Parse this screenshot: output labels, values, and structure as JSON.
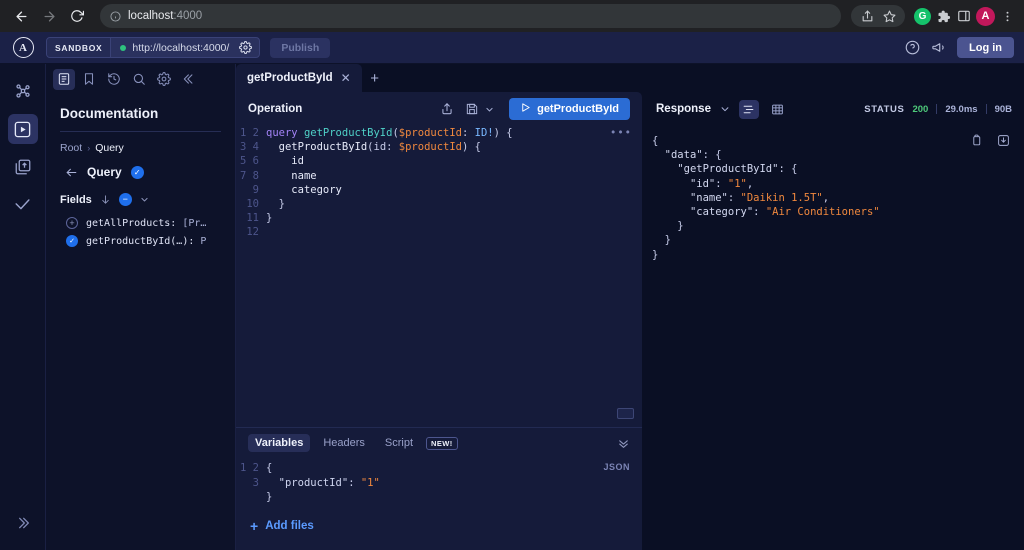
{
  "browser": {
    "back_icon": "arrow-left-icon",
    "forward_icon": "arrow-right-icon",
    "reload_icon": "reload-icon",
    "info_icon": "info-circle-icon",
    "url_host": "localhost",
    "url_port": ":4000",
    "share_icon": "share-icon",
    "bookmark_icon": "star-icon",
    "grammarly_label": "G",
    "extensions_icon": "puzzle-icon",
    "sidepanel_icon": "side-panel-icon",
    "profile_label": "A",
    "menu_icon": "kebab-menu-icon"
  },
  "apollo_top": {
    "logo_letter": "A",
    "sandbox_badge": "SANDBOX",
    "endpoint_url": "http://localhost:4000/",
    "endpoint_settings_icon": "gear-icon",
    "publish_label": "Publish",
    "help_icon": "help-circle-icon",
    "announcements_icon": "megaphone-icon",
    "login_label": "Log in"
  },
  "rail": {
    "items": [
      {
        "name": "schema-graph-icon",
        "active": false
      },
      {
        "name": "explorer-icon",
        "active": true
      },
      {
        "name": "collections-icon",
        "active": false
      },
      {
        "name": "checks-icon",
        "active": false
      }
    ],
    "expand_icon": "chevron-double-right-icon"
  },
  "docs": {
    "tabs": [
      {
        "icon": "documentation-icon",
        "active": true
      },
      {
        "icon": "bookmark-icon",
        "active": false
      },
      {
        "icon": "history-icon",
        "active": false
      },
      {
        "icon": "search-icon",
        "active": false
      },
      {
        "icon": "settings-gear-icon",
        "active": false
      },
      {
        "icon": "collapse-left-icon",
        "active": false
      }
    ],
    "title": "Documentation",
    "breadcrumb_root": "Root",
    "breadcrumb_sep": "›",
    "breadcrumb_current": "Query",
    "back_icon": "arrow-left-icon",
    "query_label": "Query",
    "query_check": "✓",
    "fields_label": "Fields",
    "sort_icon": "arrow-down-icon",
    "minus_glyph": "−",
    "chevron_glyph": "⌄",
    "fields": [
      {
        "bullet": "plus",
        "name": "getAllProducts: ",
        "ret": "[Pr…"
      },
      {
        "bullet": "check",
        "name": "getProductById(…): ",
        "ret": "P"
      }
    ]
  },
  "tabs": {
    "operation_tab": "getProductById",
    "close_glyph": "✕",
    "add_tab_glyph": "+"
  },
  "operation": {
    "title": "Operation",
    "share_icon": "share-upload-icon",
    "save_icon": "save-floppy-icon",
    "save_chevron_icon": "chevron-down-icon",
    "run_label": "getProductById",
    "run_icon": "play-icon",
    "overflow_glyph": "•••",
    "line_numbers": [
      "1",
      "2",
      "3",
      "4",
      "5",
      "6",
      "7",
      "8",
      "9",
      "10",
      "11",
      "12"
    ],
    "code": {
      "l1_kw": "query",
      "l1_name": "getProductById",
      "l1_paren_open": "(",
      "l1_var": "$productId",
      "l1_colon": ": ",
      "l1_type": "ID!",
      "l1_paren_close": ") {",
      "l2_field": "getProductById",
      "l2_args_open": "(id: ",
      "l2_var": "$productId",
      "l2_args_close": ") {",
      "l3": "id",
      "l4": "name",
      "l5": "category",
      "l6": "}",
      "l7": "}"
    },
    "kbd_hint_icon": "keyboard-icon"
  },
  "variables": {
    "tabs": [
      {
        "label": "Variables",
        "active": true
      },
      {
        "label": "Headers",
        "active": false
      },
      {
        "label": "Script",
        "active": false
      }
    ],
    "new_badge": "NEW!",
    "collapse_icon": "chevron-double-down-icon",
    "format_label": "JSON",
    "line_numbers": [
      "1",
      "2",
      "3"
    ],
    "l1": "{",
    "l2_key": "\"productId\"",
    "l2_colon": ": ",
    "l2_val": "\"1\"",
    "l3": "}",
    "add_files_label": "Add files",
    "add_files_glyph": "+"
  },
  "response": {
    "title": "Response",
    "title_chevron_icon": "chevron-down-icon",
    "view_json_icon": "json-view-icon",
    "view_table_icon": "table-view-icon",
    "status_label": "STATUS",
    "status_code": "200",
    "duration": "29.0ms",
    "size": "90B",
    "copy_icon": "clipboard-copy-icon",
    "download_icon": "download-icon",
    "lines": [
      {
        "indent": 0,
        "text": "{"
      },
      {
        "indent": 1,
        "key": "\"data\"",
        "after": ": {"
      },
      {
        "indent": 2,
        "key": "\"getProductById\"",
        "after": ": {"
      },
      {
        "indent": 3,
        "key": "\"id\"",
        "after": ": ",
        "val": "\"1\"",
        "tail": ","
      },
      {
        "indent": 3,
        "key": "\"name\"",
        "after": ": ",
        "val": "\"Daikin 1.5T\"",
        "tail": ","
      },
      {
        "indent": 3,
        "key": "\"category\"",
        "after": ": ",
        "val": "\"Air Conditioners\"",
        "tail": ""
      },
      {
        "indent": 2,
        "text": "}"
      },
      {
        "indent": 1,
        "text": "}"
      },
      {
        "indent": 0,
        "text": "}"
      }
    ]
  },
  "colors": {
    "accent_blue": "#2b6cd4",
    "status_green": "#4ec97a",
    "panel_bg": "#151b3a",
    "app_bg": "#0a0f24",
    "sidebar_bg": "#0d1229",
    "string_orange": "#f0883e",
    "keyword_purple": "#a383f7",
    "opname_teal": "#4fd1c7",
    "type_blue": "#79b8ff"
  }
}
